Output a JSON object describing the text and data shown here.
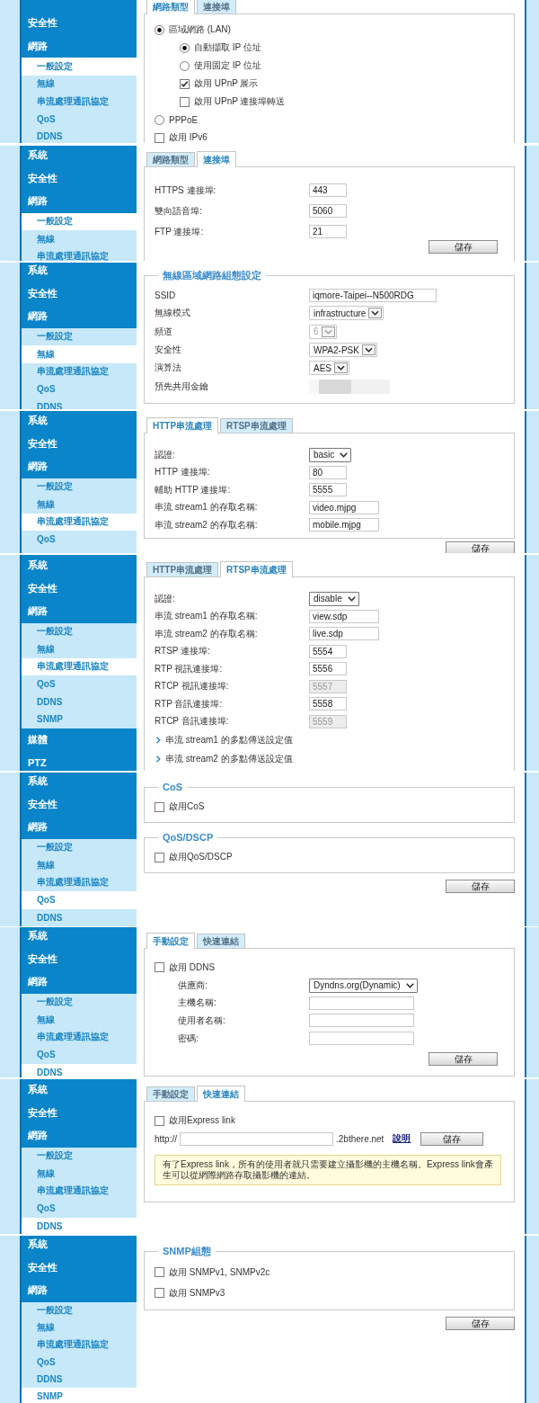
{
  "panels": [
    {
      "sidebar": [
        {
          "label": "安全性",
          "kind": "section",
          "selected": false
        },
        {
          "label": "網路",
          "kind": "section",
          "selected": false
        },
        {
          "label": "一般設定",
          "kind": "page",
          "selected": true
        },
        {
          "label": "無線",
          "kind": "page",
          "selected": false
        },
        {
          "label": "串流處理通訊協定",
          "kind": "page",
          "selected": false
        },
        {
          "label": "QoS",
          "kind": "page",
          "selected": false
        },
        {
          "label": "DDNS",
          "kind": "page",
          "selected": false
        }
      ],
      "content": [
        {
          "kind": "tabs",
          "tabs": [
            {
              "label": "網路類型",
              "selected": true
            },
            {
              "label": "連接埠",
              "selected": false
            }
          ]
        },
        {
          "kind": "box",
          "rows": [
            {
              "kind": "radio",
              "label": "區域網路 (LAN)",
              "checked": true,
              "children": [
                {
                  "kind": "radio",
                  "label": "自動擷取 IP 位址",
                  "checked": true
                },
                {
                  "kind": "radio",
                  "label": "使用固定 IP 位址",
                  "checked": false
                },
                {
                  "kind": "checkbox",
                  "label": "啟用 UPnP 展示",
                  "checked": true
                },
                {
                  "kind": "checkbox",
                  "label": "啟用 UPnP 連接埠轉送",
                  "checked": false
                }
              ]
            },
            {
              "kind": "radio",
              "label": "PPPoE",
              "checked": false
            },
            {
              "kind": "checkbox",
              "label": "啟用 IPv6",
              "checked": false
            }
          ]
        }
      ]
    },
    {
      "sidebar": [
        {
          "label": "系統",
          "kind": "section",
          "selected": false
        },
        {
          "label": "安全性",
          "kind": "section",
          "selected": false
        },
        {
          "label": "網路",
          "kind": "section",
          "selected": false
        },
        {
          "label": "一般設定",
          "kind": "page",
          "selected": true
        },
        {
          "label": "無線",
          "kind": "page",
          "selected": false
        },
        {
          "label": "串流處理通訊協定",
          "kind": "page",
          "selected": false
        }
      ],
      "content": [
        {
          "kind": "tabs",
          "tabs": [
            {
              "label": "網路類型",
              "selected": false
            },
            {
              "label": "連接埠",
              "selected": true
            }
          ]
        },
        {
          "kind": "box",
          "rows": [
            {
              "kind": "field",
              "label": "HTTPS 連接埠:",
              "value": "443"
            },
            {
              "kind": "field",
              "label": "雙向語音埠:",
              "value": "5060"
            },
            {
              "kind": "field",
              "label": "FTP 連接埠:",
              "value": "21"
            },
            {
              "kind": "button",
              "label": "儲存"
            }
          ]
        }
      ]
    },
    {
      "sidebar": [
        {
          "label": "系統",
          "kind": "section",
          "selected": false
        },
        {
          "label": "安全性",
          "kind": "section",
          "selected": false
        },
        {
          "label": "網路",
          "kind": "section",
          "selected": false
        },
        {
          "label": "一般設定",
          "kind": "page",
          "selected": false
        },
        {
          "label": "無線",
          "kind": "page",
          "selected": true
        },
        {
          "label": "串流處理通訊協定",
          "kind": "page",
          "selected": false
        },
        {
          "label": "QoS",
          "kind": "page",
          "selected": false
        },
        {
          "label": "DDNS",
          "kind": "page",
          "selected": false
        }
      ],
      "content": [
        {
          "kind": "fieldset",
          "legend": "無線區域網路組態設定",
          "rows": [
            {
              "kind": "field",
              "label": "SSID",
              "value": "iqmore-Taipei--N500RDG",
              "disabled": false
            },
            {
              "kind": "combo",
              "label": "無線模式",
              "value": "infrastructure",
              "disabled": false
            },
            {
              "kind": "combo",
              "label": "頻道",
              "value": "6",
              "disabled": true
            },
            {
              "kind": "combo",
              "label": "安全性",
              "value": "WPA2-PSK",
              "disabled": false
            },
            {
              "kind": "combo",
              "label": "演算法",
              "value": "AES",
              "disabled": false
            },
            {
              "kind": "masked",
              "label": "預先共用金鑰"
            }
          ]
        }
      ]
    },
    {
      "sidebar": [
        {
          "label": "系統",
          "kind": "section",
          "selected": false
        },
        {
          "label": "安全性",
          "kind": "section",
          "selected": false
        },
        {
          "label": "網路",
          "kind": "section",
          "selected": false
        },
        {
          "label": "一般設定",
          "kind": "page",
          "selected": false
        },
        {
          "label": "無線",
          "kind": "page",
          "selected": false
        },
        {
          "label": "串流處理通訊協定",
          "kind": "page",
          "selected": true
        },
        {
          "label": "QoS",
          "kind": "page",
          "selected": false
        }
      ],
      "content": [
        {
          "kind": "tabs",
          "tabs": [
            {
              "label": "HTTP串流處理",
              "selected": true
            },
            {
              "label": "RTSP串流處理",
              "selected": false
            }
          ]
        },
        {
          "kind": "box",
          "rows": [
            {
              "kind": "select",
              "label": "認證:",
              "value": "basic"
            },
            {
              "kind": "field",
              "label": "HTTP 連接埠:",
              "value": "80"
            },
            {
              "kind": "field",
              "label": "輔助 HTTP 連接埠:",
              "value": "5555"
            },
            {
              "kind": "field",
              "label": "串流 stream1 的存取名稱:",
              "value": "video.mjpg"
            },
            {
              "kind": "field",
              "label": "串流 stream2 的存取名稱:",
              "value": "mobile.mjpg"
            }
          ]
        },
        {
          "kind": "button",
          "label": "儲存"
        }
      ]
    },
    {
      "sidebar": [
        {
          "label": "系統",
          "kind": "section",
          "selected": false
        },
        {
          "label": "安全性",
          "kind": "section",
          "selected": false
        },
        {
          "label": "網路",
          "kind": "section",
          "selected": false
        },
        {
          "label": "一般設定",
          "kind": "page",
          "selected": false
        },
        {
          "label": "無線",
          "kind": "page",
          "selected": false
        },
        {
          "label": "串流處理通訊協定",
          "kind": "page",
          "selected": true
        },
        {
          "label": "QoS",
          "kind": "page",
          "selected": false
        },
        {
          "label": "DDNS",
          "kind": "page",
          "selected": false
        },
        {
          "label": "SNMP",
          "kind": "page",
          "selected": false
        },
        {
          "label": "媒體",
          "kind": "section",
          "selected": false
        },
        {
          "label": "PTZ",
          "kind": "section",
          "selected": false
        }
      ],
      "content": [
        {
          "kind": "tabs",
          "tabs": [
            {
              "label": "HTTP串流處理",
              "selected": false
            },
            {
              "label": "RTSP串流處理",
              "selected": true
            }
          ]
        },
        {
          "kind": "box",
          "rows": [
            {
              "kind": "select",
              "label": "認證:",
              "value": "disable",
              "disabled": false
            },
            {
              "kind": "field",
              "label": "串流 stream1 的存取名稱:",
              "value": "view.sdp",
              "disabled": false
            },
            {
              "kind": "field",
              "label": "串流 stream2 的存取名稱:",
              "value": "live.sdp",
              "disabled": false
            },
            {
              "kind": "field",
              "label": "RTSP 連接埠:",
              "value": "5554",
              "disabled": false
            },
            {
              "kind": "field",
              "label": "RTP 視訊連接埠:",
              "value": "5556",
              "disabled": false
            },
            {
              "kind": "field",
              "label": "RTCP 視訊連接埠:",
              "value": "5557",
              "disabled": true
            },
            {
              "kind": "field",
              "label": "RTP 音訊連接埠:",
              "value": "5558",
              "disabled": false
            },
            {
              "kind": "field",
              "label": "RTCP 音訊連接埠:",
              "value": "5559",
              "disabled": true
            },
            {
              "kind": "expander",
              "label": "串流 stream1 的多點傳送設定值",
              "expanded": false
            },
            {
              "kind": "expander",
              "label": "串流 stream2 的多點傳送設定值",
              "expanded": false
            }
          ]
        }
      ]
    },
    {
      "sidebar": [
        {
          "label": "系統",
          "kind": "section",
          "selected": false
        },
        {
          "label": "安全性",
          "kind": "section",
          "selected": false
        },
        {
          "label": "網路",
          "kind": "section",
          "selected": false
        },
        {
          "label": "一般設定",
          "kind": "page",
          "selected": false
        },
        {
          "label": "無線",
          "kind": "page",
          "selected": false
        },
        {
          "label": "串流處理通訊協定",
          "kind": "page",
          "selected": false
        },
        {
          "label": "QoS",
          "kind": "page",
          "selected": true
        },
        {
          "label": "DDNS",
          "kind": "page",
          "selected": false
        }
      ],
      "content": [
        {
          "kind": "fieldset",
          "legend": "CoS",
          "rows": [
            {
              "kind": "checkbox",
              "label": "啟用CoS",
              "checked": false
            }
          ]
        },
        {
          "kind": "fieldset",
          "legend": "QoS/DSCP",
          "rows": [
            {
              "kind": "checkbox",
              "label": "啟用QoS/DSCP",
              "checked": false
            }
          ]
        },
        {
          "kind": "button",
          "label": "儲存"
        }
      ]
    },
    {
      "sidebar": [
        {
          "label": "系統",
          "kind": "section",
          "selected": false
        },
        {
          "label": "安全性",
          "kind": "section",
          "selected": false
        },
        {
          "label": "網路",
          "kind": "section",
          "selected": false
        },
        {
          "label": "一般設定",
          "kind": "page",
          "selected": false
        },
        {
          "label": "無線",
          "kind": "page",
          "selected": false
        },
        {
          "label": "串流處理通訊協定",
          "kind": "page",
          "selected": false
        },
        {
          "label": "QoS",
          "kind": "page",
          "selected": false
        },
        {
          "label": "DDNS",
          "kind": "page",
          "selected": true
        }
      ],
      "content": [
        {
          "kind": "tabs",
          "tabs": [
            {
              "label": "手動設定",
              "selected": true
            },
            {
              "label": "快速連結",
              "selected": false
            }
          ]
        },
        {
          "kind": "box",
          "rows": [
            {
              "kind": "checkbox",
              "label": "啟用 DDNS",
              "checked": false,
              "children": [
                {
                  "kind": "select",
                  "label": "供應商:",
                  "value": "Dyndns.org(Dynamic)"
                },
                {
                  "kind": "field",
                  "label": "主機名稱:"
                },
                {
                  "kind": "field",
                  "label": "使用者名稱:"
                },
                {
                  "kind": "field",
                  "label": "密碼:"
                }
              ]
            },
            {
              "kind": "button",
              "label": "儲存"
            }
          ]
        }
      ]
    },
    {
      "sidebar": [
        {
          "label": "系統",
          "kind": "section",
          "selected": false
        },
        {
          "label": "安全性",
          "kind": "section",
          "selected": false
        },
        {
          "label": "網路",
          "kind": "section",
          "selected": false
        },
        {
          "label": "一般設定",
          "kind": "page",
          "selected": false
        },
        {
          "label": "無線",
          "kind": "page",
          "selected": false
        },
        {
          "label": "串流處理通訊協定",
          "kind": "page",
          "selected": false
        },
        {
          "label": "QoS",
          "kind": "page",
          "selected": false
        },
        {
          "label": "DDNS",
          "kind": "page",
          "selected": true
        }
      ],
      "content": [
        {
          "kind": "tabs",
          "tabs": [
            {
              "label": "手動設定",
              "selected": false
            },
            {
              "label": "快速連結",
              "selected": true
            }
          ]
        },
        {
          "kind": "box",
          "rows": [
            {
              "kind": "checkbox",
              "label": "啟用Express link",
              "checked": false
            },
            {
              "kind": "url",
              "prefix": "http://",
              "suffix": ".2bthere.net",
              "link": "說明",
              "button": "儲存"
            },
            {
              "kind": "note",
              "text": "有了Express link，所有的使用者就只需要建立攝影機的主機名稱。Express link會產生可以從網際網路存取攝影機的連結。"
            }
          ]
        }
      ]
    },
    {
      "sidebar": [
        {
          "label": "系統",
          "kind": "section",
          "selected": false
        },
        {
          "label": "安全性",
          "kind": "section",
          "selected": false
        },
        {
          "label": "網路",
          "kind": "section",
          "selected": false
        },
        {
          "label": "一般設定",
          "kind": "page",
          "selected": false
        },
        {
          "label": "無線",
          "kind": "page",
          "selected": false
        },
        {
          "label": "串流處理通訊協定",
          "kind": "page",
          "selected": false
        },
        {
          "label": "QoS",
          "kind": "page",
          "selected": false
        },
        {
          "label": "DDNS",
          "kind": "page",
          "selected": false
        },
        {
          "label": "SNMP",
          "kind": "page",
          "selected": true
        }
      ],
      "content": [
        {
          "kind": "fieldset",
          "legend": "SNMP組態",
          "rows": [
            {
              "kind": "checkbox",
              "label": "啟用 SNMPv1, SNMPv2c",
              "checked": false
            },
            {
              "kind": "checkbox",
              "label": "啟用 SNMPv3",
              "checked": false
            }
          ]
        },
        {
          "kind": "button",
          "label": "儲存"
        }
      ]
    }
  ]
}
